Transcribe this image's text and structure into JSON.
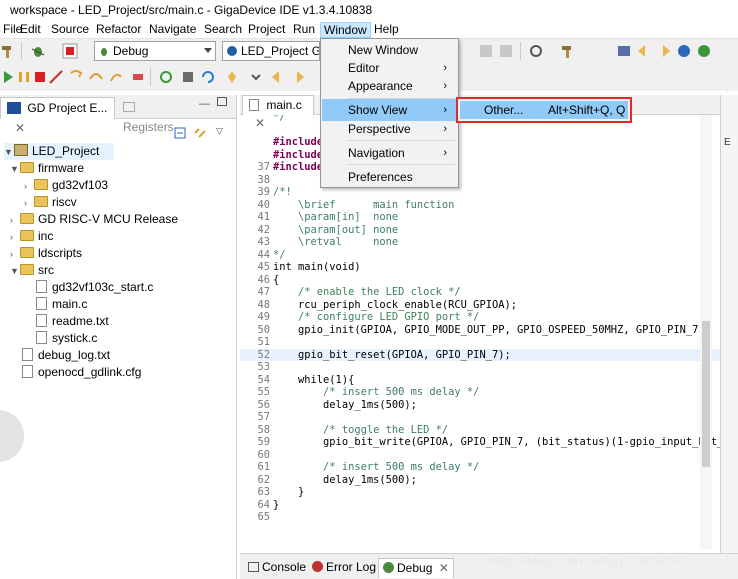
{
  "window": {
    "title": "workspace - LED_Project/src/main.c - GigaDevice IDE v1.3.4.10838"
  },
  "menubar": [
    "File",
    "Edit",
    "Source",
    "Refactor",
    "Navigate",
    "Search",
    "Project",
    "Run",
    "Window",
    "Help"
  ],
  "toolbar": {
    "run_config": "Debug",
    "launch_target": "LED_Project GD"
  },
  "left_panel": {
    "tabs": [
      "GD Project E...",
      "Registers"
    ],
    "tree": [
      {
        "label": "LED_Project",
        "type": "project",
        "expanded": true
      },
      {
        "label": "firmware",
        "type": "folder",
        "expanded": true
      },
      {
        "label": "gd32vf103",
        "type": "folder",
        "expanded": false
      },
      {
        "label": "riscv",
        "type": "folder",
        "expanded": false
      },
      {
        "label": "GD RISC-V MCU Release",
        "type": "folder",
        "expanded": false
      },
      {
        "label": "inc",
        "type": "folder",
        "expanded": false
      },
      {
        "label": "ldscripts",
        "type": "folder",
        "expanded": false
      },
      {
        "label": "src",
        "type": "folder",
        "expanded": true
      },
      {
        "label": "gd32vf103c_start.c",
        "type": "file"
      },
      {
        "label": "main.c",
        "type": "file"
      },
      {
        "label": "readme.txt",
        "type": "file"
      },
      {
        "label": "systick.c",
        "type": "file"
      },
      {
        "label": "debug_log.txt",
        "type": "file"
      },
      {
        "label": "openocd_gdlink.cfg",
        "type": "file"
      }
    ]
  },
  "editor": {
    "tab": "main.c",
    "lines": [
      {
        "n": "",
        "t": "*/"
      },
      {
        "n": "",
        "t": ""
      },
      {
        "n": "",
        "t": "#include"
      },
      {
        "n": "",
        "t": "#include"
      },
      {
        "n": "37",
        "t": "#include"
      },
      {
        "n": "38",
        "t": ""
      },
      {
        "n": "39",
        "t": "/*!"
      },
      {
        "n": "40",
        "t": "    \\brief      main function"
      },
      {
        "n": "41",
        "t": "    \\param[in]  none"
      },
      {
        "n": "42",
        "t": "    \\param[out] none"
      },
      {
        "n": "43",
        "t": "    \\retval     none"
      },
      {
        "n": "44",
        "t": "*/"
      },
      {
        "n": "45",
        "t": "int main(void)"
      },
      {
        "n": "46",
        "t": "{"
      },
      {
        "n": "47",
        "t": "    /* enable the LED clock */"
      },
      {
        "n": "48",
        "t": "    rcu_periph_clock_enable(RCU_GPIOA);"
      },
      {
        "n": "49",
        "t": "    /* configure LED GPIO port */"
      },
      {
        "n": "50",
        "t": "    gpio_init(GPIOA, GPIO_MODE_OUT_PP, GPIO_OSPEED_50MHZ, GPIO_PIN_7);"
      },
      {
        "n": "51",
        "t": ""
      },
      {
        "n": "52",
        "t": "    gpio_bit_reset(GPIOA, GPIO_PIN_7);"
      },
      {
        "n": "53",
        "t": ""
      },
      {
        "n": "54",
        "t": "    while(1){"
      },
      {
        "n": "55",
        "t": "        /* insert 500 ms delay */"
      },
      {
        "n": "56",
        "t": "        delay_1ms(500);"
      },
      {
        "n": "57",
        "t": ""
      },
      {
        "n": "58",
        "t": "        /* toggle the LED */"
      },
      {
        "n": "59",
        "t": "        gpio_bit_write(GPIOA, GPIO_PIN_7, (bit_status)(1-gpio_input_bit_"
      },
      {
        "n": "60",
        "t": ""
      },
      {
        "n": "61",
        "t": "        /* insert 500 ms delay */"
      },
      {
        "n": "62",
        "t": "        delay_1ms(500);"
      },
      {
        "n": "63",
        "t": "    }"
      },
      {
        "n": "64",
        "t": "}"
      },
      {
        "n": "65",
        "t": ""
      }
    ]
  },
  "window_menu": {
    "items": [
      "New Window",
      "Editor",
      "Appearance",
      "Show View",
      "Perspective",
      "Navigation",
      "Preferences"
    ]
  },
  "show_view_submenu": {
    "item": "Other...",
    "shortcut": "Alt+Shift+Q, Q"
  },
  "bottom_tabs": [
    "Console",
    "Error Log",
    "Debug"
  ],
  "watermark": "https://blog.csdn.net/qq_23852045",
  "colors": {
    "menu_highlight": "#91c9f7",
    "callout_border": "#e32a2a",
    "keyword": "#7f0055",
    "comment": "#3f7f5f"
  }
}
